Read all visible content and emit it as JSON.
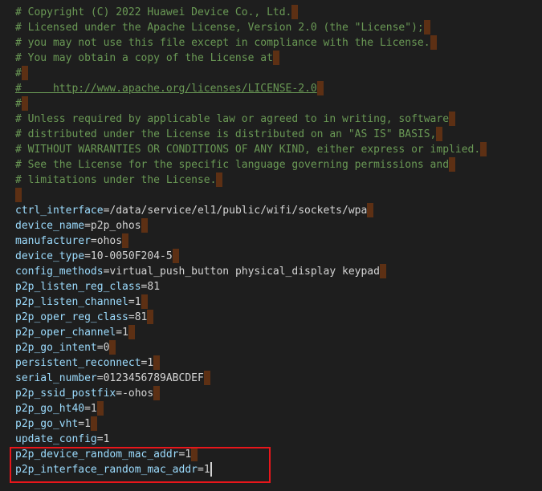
{
  "colors": {
    "background": "#1e1e1e",
    "comment": "#6a9955",
    "key": "#9cdcfe",
    "value": "#d4d4d4",
    "trailing_space_marker": "#613214",
    "highlight_border": "#e8161b"
  },
  "comments": [
    "# Copyright (C) 2022 Huawei Device Co., Ltd.",
    "# Licensed under the Apache License, Version 2.0 (the \"License\");",
    "# you may not use this file except in compliance with the License.",
    "# You may obtain a copy of the License at",
    "#",
    "#     http://www.apache.org/licenses/LICENSE-2.0",
    "#",
    "# Unless required by applicable law or agreed to in writing, software",
    "# distributed under the License is distributed on an \"AS IS\" BASIS,",
    "# WITHOUT WARRANTIES OR CONDITIONS OF ANY KIND, either express or implied.",
    "# See the License for the specific language governing permissions and",
    "# limitations under the License."
  ],
  "config": [
    {
      "key": "ctrl_interface",
      "value": "/data/service/el1/public/wifi/sockets/wpa"
    },
    {
      "key": "device_name",
      "value": "p2p_ohos"
    },
    {
      "key": "manufacturer",
      "value": "ohos"
    },
    {
      "key": "device_type",
      "value": "10-0050F204-5"
    },
    {
      "key": "config_methods",
      "value": "virtual_push_button physical_display keypad"
    },
    {
      "key": "p2p_listen_reg_class",
      "value": "81"
    },
    {
      "key": "p2p_listen_channel",
      "value": "1"
    },
    {
      "key": "p2p_oper_reg_class",
      "value": "81"
    },
    {
      "key": "p2p_oper_channel",
      "value": "1"
    },
    {
      "key": "p2p_go_intent",
      "value": "0"
    },
    {
      "key": "persistent_reconnect",
      "value": "1"
    },
    {
      "key": "serial_number",
      "value": "0123456789ABCDEF"
    },
    {
      "key": "p2p_ssid_postfix",
      "value": "-ohos"
    },
    {
      "key": "p2p_go_ht40",
      "value": "1"
    },
    {
      "key": "p2p_go_vht",
      "value": "1"
    },
    {
      "key": "update_config",
      "value": "1"
    },
    {
      "key": "p2p_device_random_mac_addr",
      "value": "1"
    },
    {
      "key": "p2p_interface_random_mac_addr",
      "value": "1"
    }
  ],
  "operator": "="
}
